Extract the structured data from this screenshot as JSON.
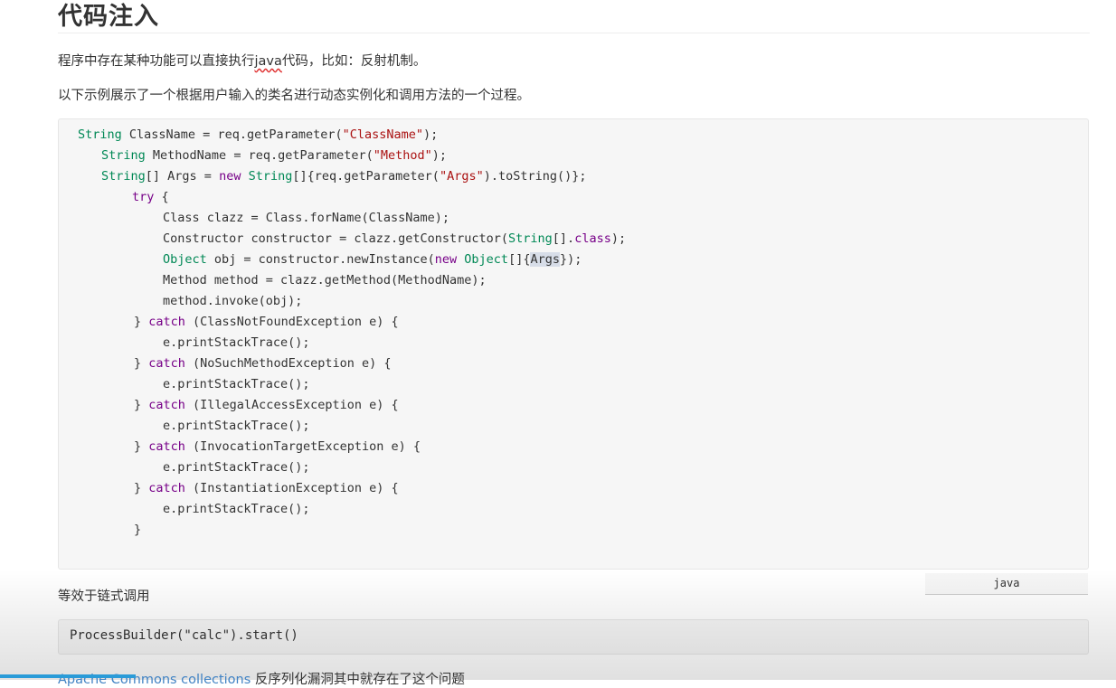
{
  "heading": "代码注入",
  "para1": {
    "before": "程序中存在某种功能可以直接执行",
    "marked": "java",
    "after": "代码，比如：反射机制。"
  },
  "para2": "以下示例展示了一个根据用户输入的类名进行动态实例化和调用方法的一个过程。",
  "code_language": "java",
  "equivalent_text": "等效于链式调用",
  "inline_code": "ProcessBuilder(\"calc\").start()",
  "bottom_text": {
    "link": "Apache Commons collections",
    "rest": " 反序列化漏洞其中就存在了这个问题"
  },
  "colors": {
    "keyword": "#770088",
    "type": "#008855",
    "string": "#aa1111",
    "code_bg": "#f6f6f6",
    "link": "#4183c4"
  },
  "code_lines": [
    [
      [
        "String",
        "ty"
      ],
      [
        " ClassName = req.getParameter(",
        ""
      ],
      [
        "\"ClassName\"",
        "st"
      ],
      [
        ");",
        ""
      ]
    ],
    [
      [
        "String",
        "ty"
      ],
      [
        " MethodName = req.getParameter(",
        ""
      ],
      [
        "\"Method\"",
        "st"
      ],
      [
        ");",
        ""
      ]
    ],
    [
      [
        "String",
        "ty"
      ],
      [
        "[] Args = ",
        ""
      ],
      [
        "new",
        "kw"
      ],
      [
        " ",
        ""
      ],
      [
        "String",
        "ty"
      ],
      [
        "[]{req.getParameter(",
        ""
      ],
      [
        "\"Args\"",
        "st"
      ],
      [
        ").toString()};",
        ""
      ]
    ],
    [
      [
        "try",
        "kw"
      ],
      [
        " {",
        ""
      ]
    ],
    [
      [
        "Class clazz = Class.forName(ClassName);",
        ""
      ]
    ],
    [
      [
        "Constructor constructor = clazz.getConstructor(",
        ""
      ],
      [
        "String",
        "ty"
      ],
      [
        "[].",
        ""
      ],
      [
        "class",
        "kw"
      ],
      [
        ");",
        ""
      ]
    ],
    [
      [
        "Object",
        "ty"
      ],
      [
        " obj = constructor.newInstance(",
        ""
      ],
      [
        "new",
        "kw"
      ],
      [
        " ",
        ""
      ],
      [
        "Object",
        "ty"
      ],
      [
        "[]{",
        ""
      ],
      [
        "Args",
        "sel"
      ],
      [
        "});",
        ""
      ]
    ],
    [
      [
        "Method method = clazz.getMethod(MethodName);",
        ""
      ]
    ],
    [
      [
        "method.invoke(obj);",
        ""
      ]
    ],
    [
      [
        "} ",
        ""
      ],
      [
        "catch",
        "kw"
      ],
      [
        " (ClassNotFoundException e) {",
        ""
      ]
    ],
    [
      [
        "e.printStackTrace();",
        ""
      ]
    ],
    [
      [
        "} ",
        ""
      ],
      [
        "catch",
        "kw"
      ],
      [
        " (NoSuchMethodException e) {",
        ""
      ]
    ],
    [
      [
        "e.printStackTrace();",
        ""
      ]
    ],
    [
      [
        "} ",
        ""
      ],
      [
        "catch",
        "kw"
      ],
      [
        " (IllegalAccessException e) {",
        ""
      ]
    ],
    [
      [
        "e.printStackTrace();",
        ""
      ]
    ],
    [
      [
        "} ",
        ""
      ],
      [
        "catch",
        "kw"
      ],
      [
        " (InvocationTargetException e) {",
        ""
      ]
    ],
    [
      [
        "e.printStackTrace();",
        ""
      ]
    ],
    [
      [
        "} ",
        ""
      ],
      [
        "catch",
        "kw"
      ],
      [
        " (InstantiationException e) {",
        ""
      ]
    ],
    [
      [
        "e.printStackTrace();",
        ""
      ]
    ],
    [
      [
        "}",
        ""
      ]
    ]
  ]
}
